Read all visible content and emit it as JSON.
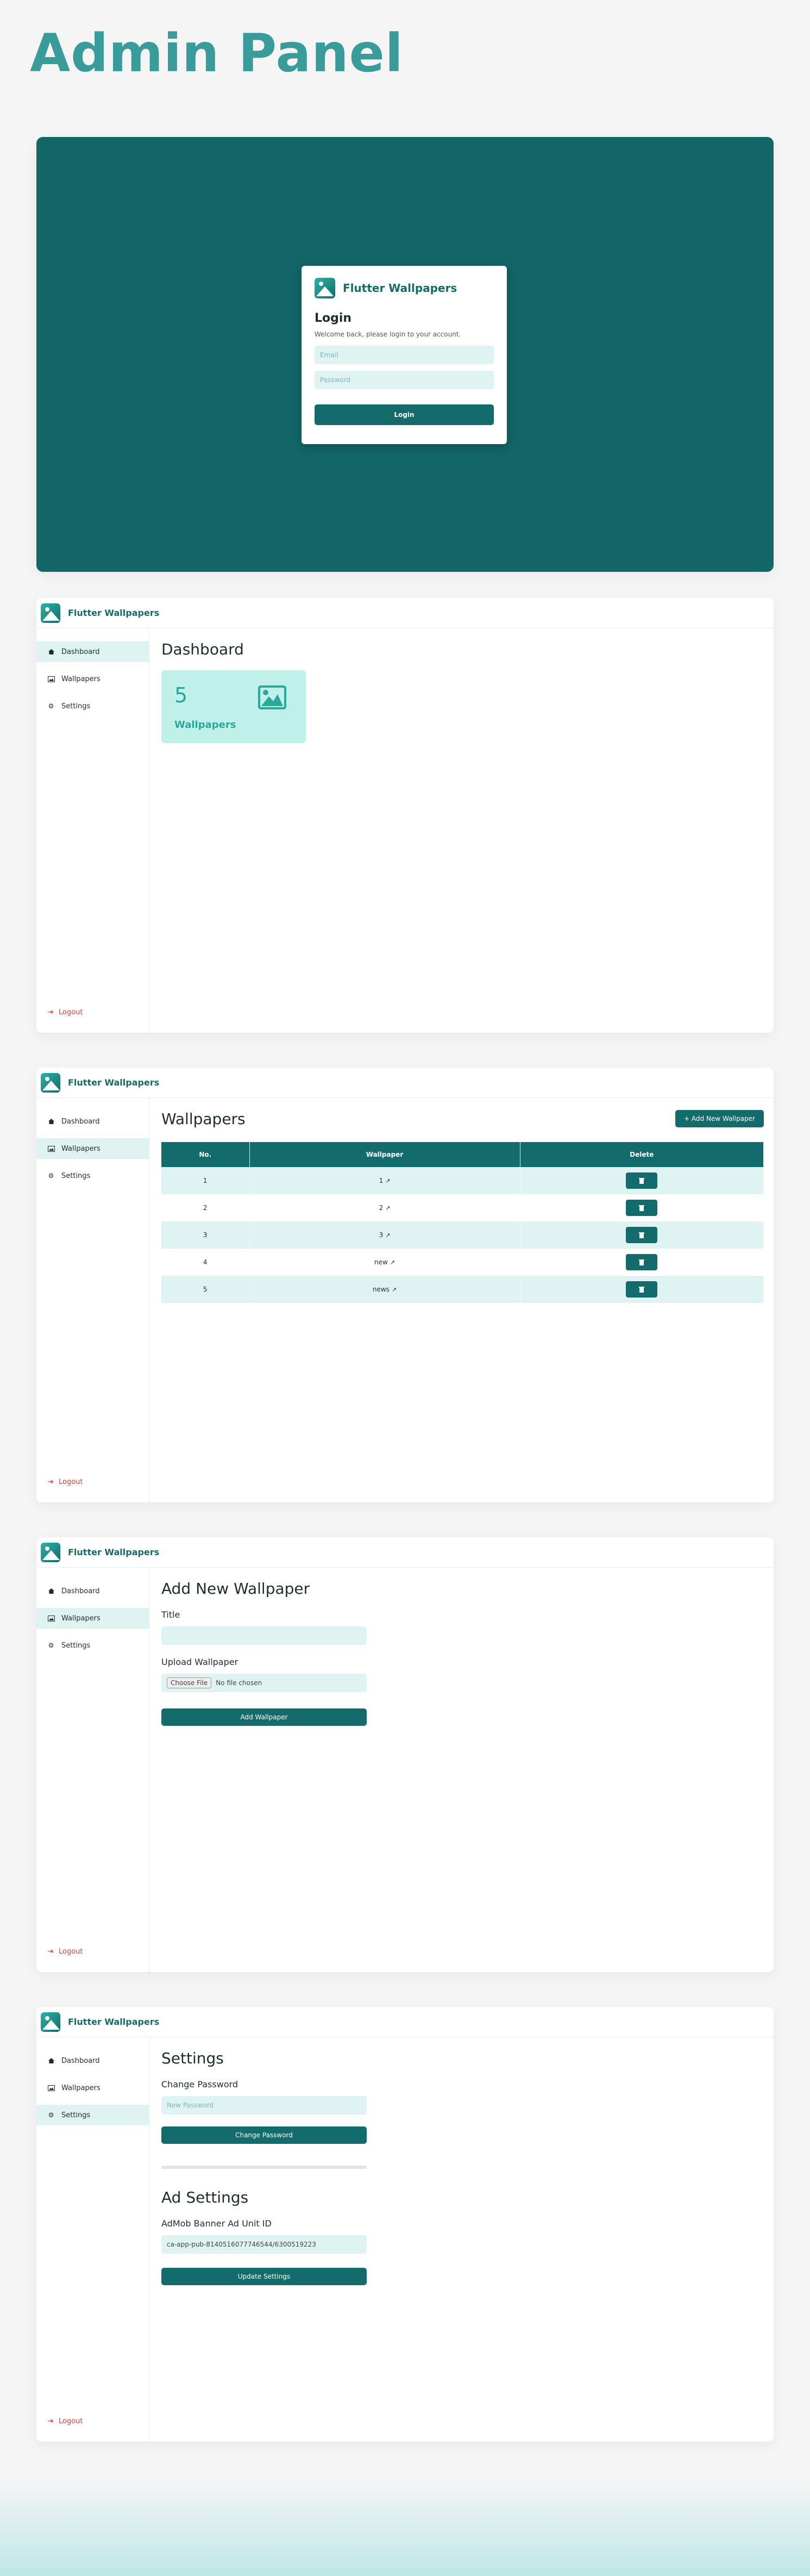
{
  "page": {
    "heading": "Admin Panel"
  },
  "brand": {
    "name": "Flutter Wallpapers"
  },
  "login": {
    "title": "Login",
    "subtitle": "Welcome back, please login to your account.",
    "email_placeholder": "Email",
    "password_placeholder": "Password",
    "button": "Login"
  },
  "sidebar": {
    "items": [
      {
        "label": "Dashboard",
        "icon": "dashboard-icon"
      },
      {
        "label": "Wallpapers",
        "icon": "image-icon"
      },
      {
        "label": "Settings",
        "icon": "gear-icon"
      }
    ],
    "logout": "Logout"
  },
  "dashboard": {
    "title": "Dashboard",
    "stat": {
      "count": "5",
      "label": "Wallpapers"
    }
  },
  "wallpapers": {
    "title": "Wallpapers",
    "add_button": "+ Add New Wallpaper",
    "columns": [
      "No.",
      "Wallpaper",
      "Delete"
    ],
    "rows": [
      {
        "no": "1",
        "name": "1"
      },
      {
        "no": "2",
        "name": "2"
      },
      {
        "no": "3",
        "name": "3"
      },
      {
        "no": "4",
        "name": "new"
      },
      {
        "no": "5",
        "name": "news"
      }
    ]
  },
  "add_wallpaper": {
    "title": "Add New Wallpaper",
    "title_label": "Title",
    "title_value": "",
    "upload_label": "Upload Wallpaper",
    "file_button": "Choose File",
    "file_text": "No file chosen",
    "submit": "Add Wallpaper"
  },
  "settings": {
    "title": "Settings",
    "change_password_label": "Change Password",
    "new_password_placeholder": "New Password",
    "change_password_button": "Change Password",
    "ad_title": "Ad Settings",
    "admob_label": "AdMob Banner Ad Unit ID",
    "admob_value": "ca-app-pub-8140516077746544/6300519223",
    "update_button": "Update Settings"
  },
  "colors": {
    "primary": "#146b6c",
    "accent": "#3a9b9b",
    "light": "#dff3f3",
    "danger": "#e53935"
  }
}
